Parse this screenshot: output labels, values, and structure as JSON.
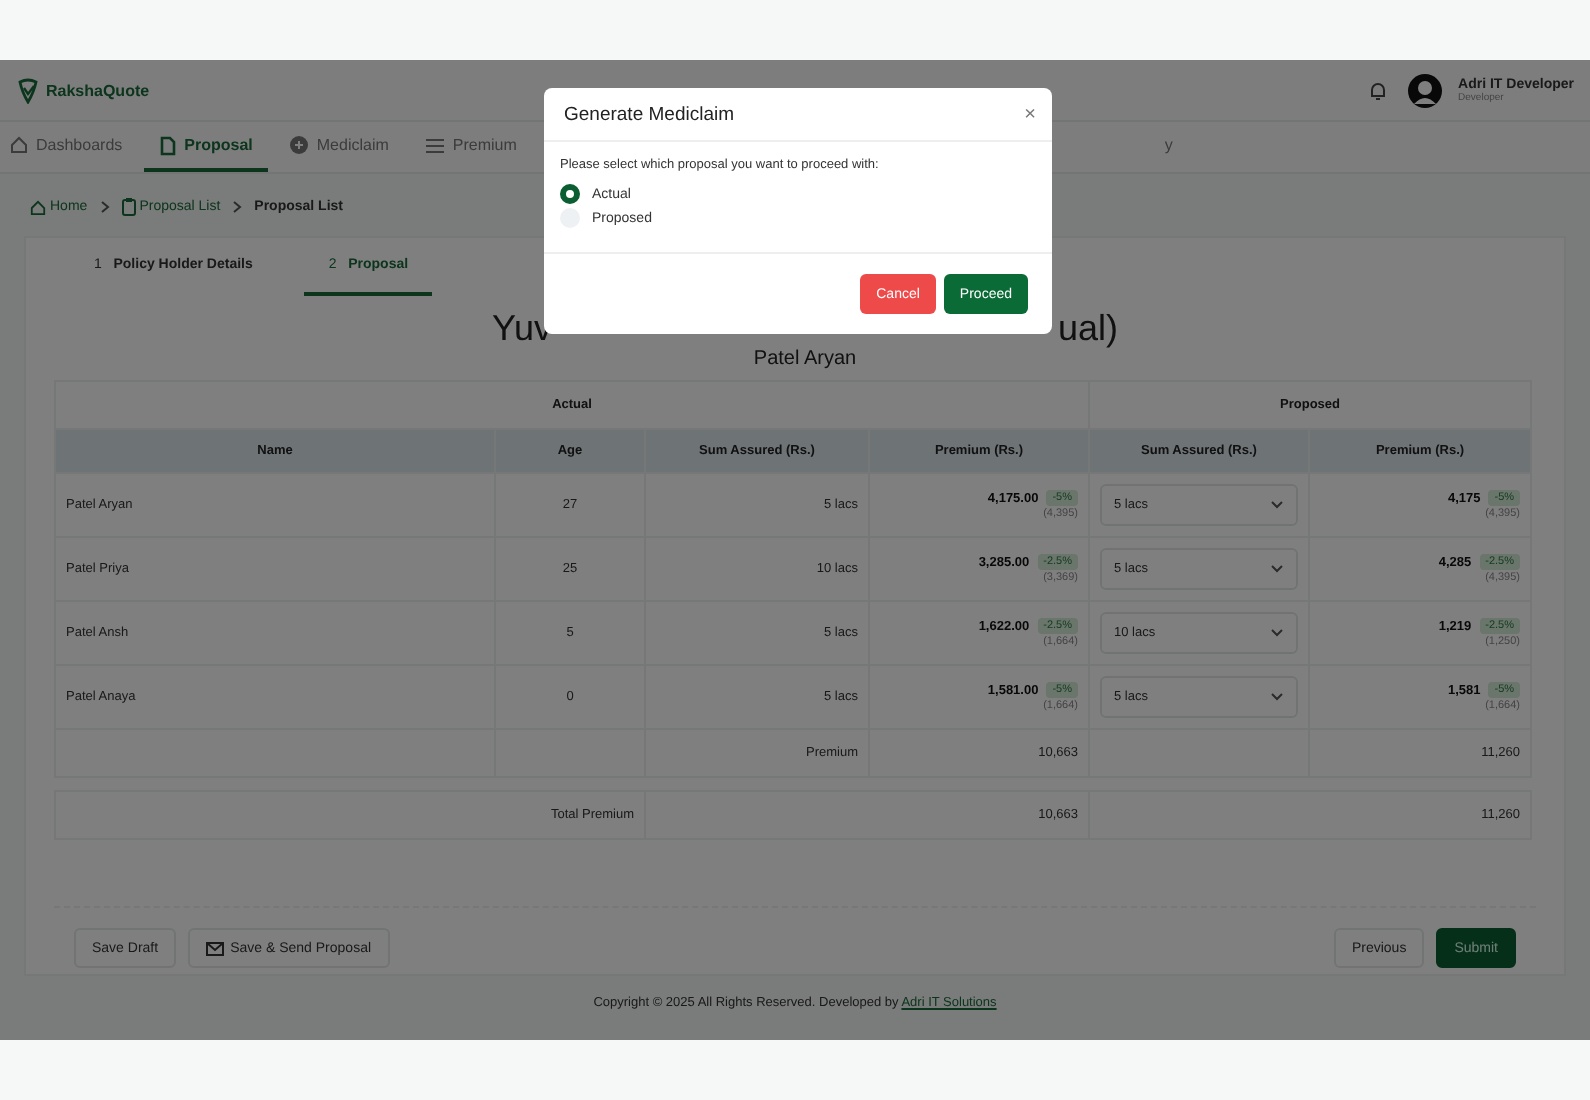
{
  "header": {
    "brand": "RakshaQuote",
    "user_name": "Adri IT Developer",
    "user_role": "Developer"
  },
  "nav": [
    {
      "label": "Dashboards",
      "selected": false
    },
    {
      "label": "Proposal",
      "selected": true
    },
    {
      "label": "Mediclaim",
      "selected": false
    },
    {
      "label": "Premium",
      "selected": false
    },
    {
      "label": "y",
      "selected": false
    }
  ],
  "breadcrumb": [
    {
      "label": "Home",
      "current": false
    },
    {
      "label": "Proposal List",
      "current": false
    },
    {
      "label": "Proposal List",
      "current": true
    }
  ],
  "steps": [
    {
      "number": "1",
      "label": "Policy Holder Details",
      "selected": false
    },
    {
      "number": "2",
      "label": "Proposal",
      "selected": true
    }
  ],
  "heading": {
    "visible_start": "Yuv",
    "visible_end": "ual)",
    "subtitle": "Patel Aryan"
  },
  "table": {
    "groups": [
      "Actual",
      "Proposed"
    ],
    "columns": [
      "Name",
      "Age",
      "Sum Assured (Rs.)",
      "Premium (Rs.)",
      "Sum Assured (Rs.)",
      "Premium (Rs.)"
    ],
    "rows": [
      {
        "name": "Patel Aryan",
        "age": "27",
        "sum_assured": "5 lacs",
        "premium": "4,175.00",
        "discount": "-5%",
        "base": "(4,395)",
        "proposed_sum": "5 lacs",
        "proposed_premium": "4,175",
        "proposed_discount": "-5%",
        "proposed_base": "(4,395)"
      },
      {
        "name": "Patel Priya",
        "age": "25",
        "sum_assured": "10 lacs",
        "premium": "3,285.00",
        "discount": "-2.5%",
        "base": "(3,369)",
        "proposed_sum": "5 lacs",
        "proposed_premium": "4,285",
        "proposed_discount": "-2.5%",
        "proposed_base": "(4,395)"
      },
      {
        "name": "Patel Ansh",
        "age": "5",
        "sum_assured": "5 lacs",
        "premium": "1,622.00",
        "discount": "-2.5%",
        "base": "(1,664)",
        "proposed_sum": "10 lacs",
        "proposed_premium": "1,219",
        "proposed_discount": "-2.5%",
        "proposed_base": "(1,250)"
      },
      {
        "name": "Patel Anaya",
        "age": "0",
        "sum_assured": "5 lacs",
        "premium": "1,581.00",
        "discount": "-5%",
        "base": "(1,664)",
        "proposed_sum": "5 lacs",
        "proposed_premium": "1,581",
        "proposed_discount": "-5%",
        "proposed_base": "(1,664)"
      }
    ],
    "premium_row": {
      "label": "Premium",
      "actual": "10,663",
      "proposed": "11,260"
    },
    "total_row": {
      "label": "Total Premium",
      "actual": "10,663",
      "proposed": "11,260"
    }
  },
  "actions": {
    "left": [
      "Save Draft",
      "Save & Send Proposal"
    ],
    "right": [
      "Previous",
      "Submit"
    ]
  },
  "footer": {
    "text": "Copyright © 2025 All Rights Reserved. Developed by",
    "link": "Adri IT Solutions"
  },
  "modal": {
    "title": "Generate Mediclaim",
    "close": "×",
    "prompt": "Please select which proposal you want to proceed with:",
    "options": [
      {
        "label": "Actual",
        "selected": true
      },
      {
        "label": "Proposed",
        "selected": false
      }
    ],
    "buttons": [
      {
        "label": "Cancel",
        "kind": "danger"
      },
      {
        "label": "Proceed",
        "kind": "primary"
      }
    ]
  }
}
